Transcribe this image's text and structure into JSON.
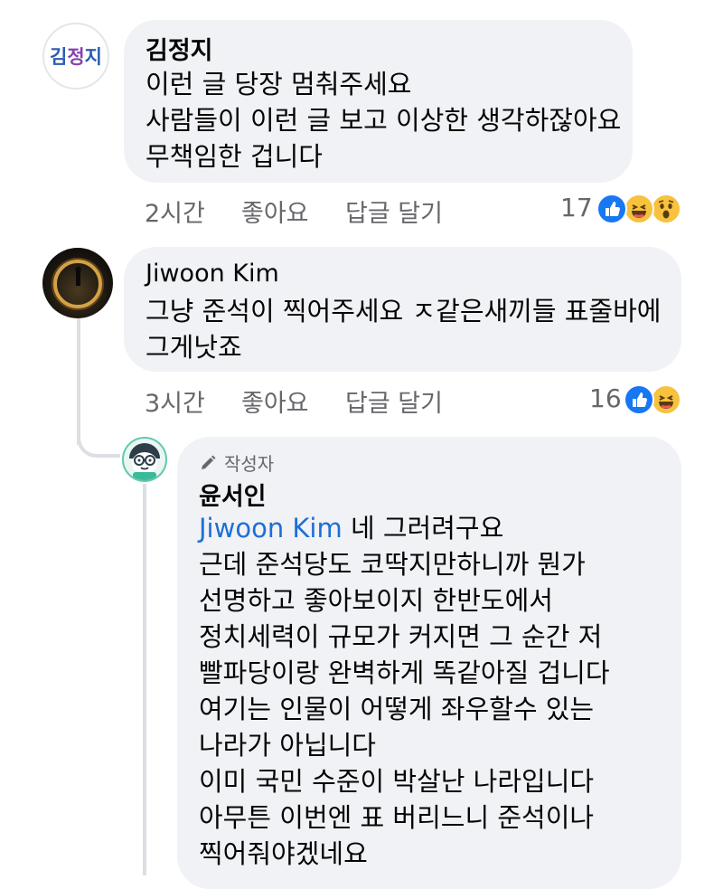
{
  "comments": [
    {
      "avatar_text": [
        "김",
        "정",
        "지"
      ],
      "author": "김정지",
      "lines": [
        "이런 글 당장 멈춰주세요",
        "사람들이 이런 글 보고 이상한 생각하잖아요",
        "무책임한 겁니다"
      ],
      "time": "2시간",
      "like_label": "좋아요",
      "reply_label": "답글 달기",
      "reaction_count": "17",
      "reactions": [
        "like-icon",
        "haha-icon",
        "wow-icon"
      ]
    },
    {
      "author": "Jiwoon Kim",
      "lines": [
        "그냥 준석이 찍어주세요 ㅈ같은새끼들 표줄바에",
        "그게낫죠"
      ],
      "time": "3시간",
      "like_label": "좋아요",
      "reply_label": "답글 달기",
      "reaction_count": "16",
      "reactions": [
        "like-icon",
        "haha-icon"
      ]
    },
    {
      "badge": "작성자",
      "author": "윤서인",
      "mention": "Jiwoon Kim",
      "first_line_rest": " 네 그러려구요",
      "lines": [
        "근데 준석당도 코딱지만하니까 뭔가",
        "선명하고 좋아보이지 한반도에서",
        "정치세력이 규모가 커지면 그 순간 저",
        "빨파당이랑 완벽하게 똑같아질 겁니다",
        "여기는 인물이 어떻게 좌우할수 있는",
        "나라가 아닙니다",
        "이미 국민 수준이 박살난 나라입니다",
        "아무튼 이번엔 표 버리느니 준석이나",
        "찍어줘야겠네요"
      ]
    }
  ],
  "colors": {
    "bubble": "#f0f2f5",
    "meta": "#65676b",
    "mention": "#1d6fd6",
    "like_blue": "#1877f2",
    "emoji_yellow": "#f7c23d",
    "avatar_blue": "#2a5db0",
    "avatar_purple": "#8a3fb0"
  }
}
